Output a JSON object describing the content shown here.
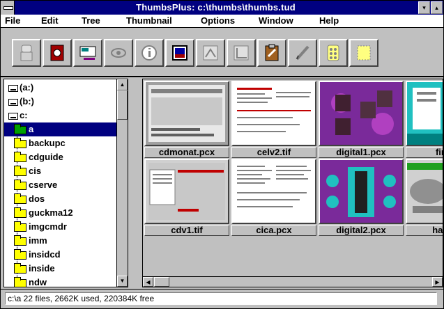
{
  "window": {
    "title": "ThumbsPlus: c:\\thumbs\\thumbs.tud"
  },
  "title_buttons": {
    "minimize": "▾",
    "maximize": "▴"
  },
  "menu": [
    {
      "label": "File",
      "accel": "F"
    },
    {
      "label": "Edit",
      "accel": "E"
    },
    {
      "label": "Tree",
      "accel": "T"
    },
    {
      "label": "Thumbnail",
      "accel": "n"
    },
    {
      "label": "Options",
      "accel": "O"
    },
    {
      "label": "Window",
      "accel": "W"
    },
    {
      "label": "Help",
      "accel": "H"
    }
  ],
  "toolbar": [
    {
      "name": "scanner-icon"
    },
    {
      "name": "camera-icon"
    },
    {
      "name": "slideshow-icon"
    },
    {
      "name": "eye-icon"
    },
    {
      "name": "info-icon"
    },
    {
      "name": "viewer-icon"
    },
    {
      "name": "graph-icon"
    },
    {
      "name": "chart-icon"
    },
    {
      "name": "clipboard-icon"
    },
    {
      "name": "pencil-icon"
    },
    {
      "name": "grid-icon"
    },
    {
      "name": "crop-icon"
    }
  ],
  "tree": {
    "drives": [
      "(a:)",
      "(b:)",
      "c:"
    ],
    "selected": "a",
    "folders": [
      "backupc",
      "cdguide",
      "cis",
      "cserve",
      "dos",
      "guckma12",
      "imgcmdr",
      "imm",
      "insidcd",
      "inside",
      "ndw"
    ]
  },
  "scroll": {
    "up": "▲",
    "down": "▼",
    "left": "◀",
    "right": "▶"
  },
  "thumbnails": [
    {
      "name": "cdmonat.pcx"
    },
    {
      "name": "celv2.tif"
    },
    {
      "name": "digital1.pcx"
    },
    {
      "name": "finger"
    },
    {
      "name": "cdv1.tif"
    },
    {
      "name": "cica.pcx"
    },
    {
      "name": "digital2.pcx"
    },
    {
      "name": "hardwa"
    }
  ],
  "status": {
    "text": "c:\\a 22 files, 2662K used, 220384K free"
  },
  "colors": {
    "titlebar": "#000080",
    "face": "#c0c0c0",
    "folder": "#ffff00"
  }
}
